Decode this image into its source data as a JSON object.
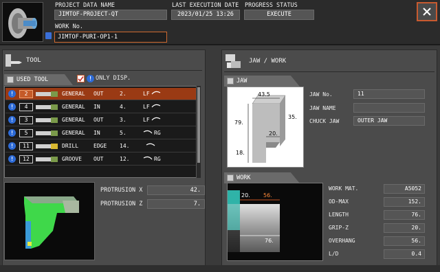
{
  "header": {
    "project_label": "PROJECT DATA NAME",
    "project_value": "JIMTOF-PROJECT-QT",
    "last_exec_label": "LAST EXECUTION DATE",
    "last_exec_value": "2023/01/25 13:26",
    "progress_label": "PROGRESS STATUS",
    "progress_value": "EXECUTE",
    "work_no_label": "WORK No.",
    "work_no_value": "JIMTOF-PURI-OP1-1",
    "close_icon": "close-icon"
  },
  "tool": {
    "section_label": "TOOL",
    "used_tool_tab": "USED TOOL",
    "only_disp_label": "ONLY DISP.",
    "only_disp_checked": true,
    "rows": [
      {
        "num": "2",
        "type": "GENERAL",
        "dir": "OUT",
        "pos": "2.",
        "hand": "LF",
        "icon": "wrench-general-icon",
        "selected": true
      },
      {
        "num": "4",
        "type": "GENERAL",
        "dir": "IN",
        "pos": "4.",
        "hand": "LF",
        "icon": "wrench-general-icon",
        "selected": false
      },
      {
        "num": "3",
        "type": "GENERAL",
        "dir": "OUT",
        "pos": "3.",
        "hand": "LF",
        "icon": "wrench-general-icon",
        "selected": false
      },
      {
        "num": "5",
        "type": "GENERAL",
        "dir": "IN",
        "pos": "5.",
        "hand": "RG",
        "icon": "wrench-general-icon",
        "selected": false
      },
      {
        "num": "11",
        "type": "DRILL",
        "dir": "EDGE",
        "pos": "14.",
        "hand": "",
        "icon": "drill-icon",
        "selected": false
      },
      {
        "num": "12",
        "type": "GROOVE",
        "dir": "OUT",
        "pos": "12.",
        "hand": "RG",
        "icon": "groove-tool-icon",
        "selected": false
      }
    ],
    "protrusion_x_label": "PROTRUSION X",
    "protrusion_x_value": "42.",
    "protrusion_z_label": "PROTRUSION Z",
    "protrusion_z_value": "7."
  },
  "jaw_work": {
    "section_label": "JAW / WORK",
    "jaw_tab": "JAW",
    "jaw_no_label": "JAW No.",
    "jaw_no_value": "11",
    "jaw_name_label": "JAW NAME",
    "jaw_name_value": "",
    "chuck_jaw_label": "CHUCK JAW",
    "chuck_jaw_value": "OUTER JAW",
    "jaw_dims": {
      "top": "43.5",
      "side": "35.",
      "height": "79.",
      "step": "20.",
      "bottom": "18."
    },
    "work_tab": "WORK",
    "work_mat_label": "WORK MAT.",
    "work_mat_value": "A5052",
    "od_max_label": "OD-MAX",
    "od_max_value": "152.",
    "length_label": "LENGTH",
    "length_value": "76.",
    "grip_z_label": "GRIP-Z",
    "grip_z_value": "20.",
    "overhang_label": "OVERHANG",
    "overhang_value": "56.",
    "ld_label": "L/D",
    "ld_value": "0.4",
    "work_dims": {
      "grip": "20.",
      "overhang": "56.",
      "length": "76."
    }
  },
  "colors": {
    "accent_orange": "#c85a30",
    "selected_row": "#9a3a14",
    "info_blue": "#2d6bd8",
    "work_teal": "#2fb3a8",
    "jaw_green": "#3bd84a"
  }
}
